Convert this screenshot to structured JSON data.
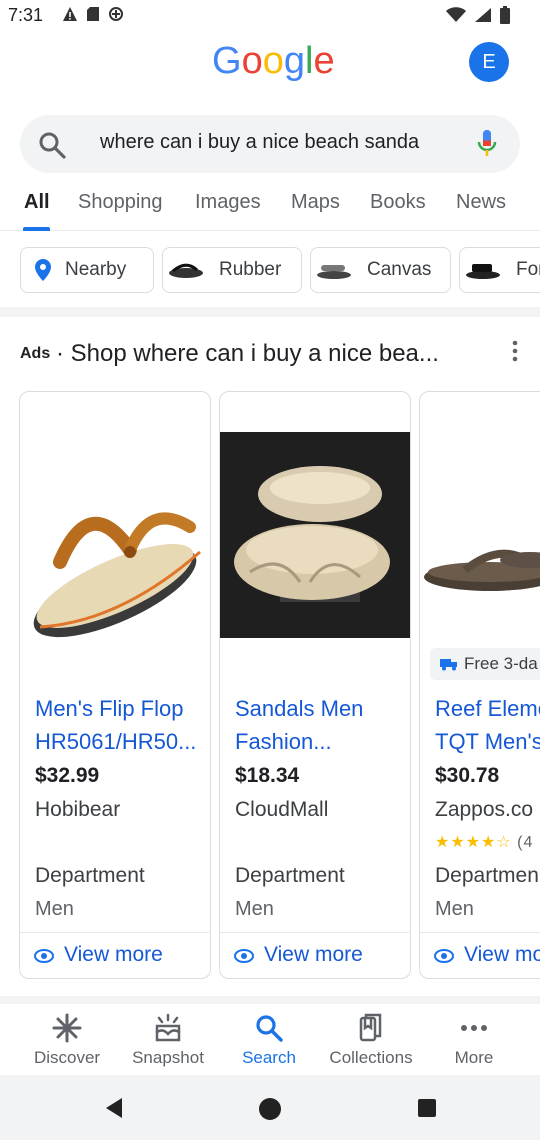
{
  "status_bar": {
    "time": "7:31",
    "left_icons": [
      "alert-icon",
      "sd-card-icon",
      "data-saver-icon"
    ],
    "right_icons": [
      "wifi-icon",
      "signal-icon",
      "battery-icon"
    ]
  },
  "header": {
    "logo_text": "Google",
    "logo_colors": [
      "#4285F4",
      "#EA4335",
      "#FBBC05",
      "#4285F4",
      "#34A853",
      "#EA4335"
    ],
    "avatar_letter": "E",
    "avatar_color": "#1a73e8"
  },
  "search": {
    "query": "where can i buy a nice beach sanda"
  },
  "tabs": [
    {
      "label": "All",
      "active": true
    },
    {
      "label": "Shopping"
    },
    {
      "label": "Images"
    },
    {
      "label": "Maps"
    },
    {
      "label": "Books"
    },
    {
      "label": "News"
    }
  ],
  "chips": [
    {
      "label": "Nearby",
      "icon": "location-pin-icon"
    },
    {
      "label": "Rubber",
      "icon": "flip-flop-thumbnail"
    },
    {
      "label": "Canvas",
      "icon": "sandal-thumbnail"
    },
    {
      "label": "For",
      "icon": "sport-sandal-thumbnail"
    }
  ],
  "ads": {
    "label": "Ads",
    "title": "· Shop where can i buy a nice bea..."
  },
  "products": [
    {
      "title_line1": "Men's Flip Flop",
      "title_line2": "HR5061/HR50...",
      "price": "$32.99",
      "store": "Hobibear",
      "department": "Department",
      "gender": "Men",
      "view_more": "View more"
    },
    {
      "title_line1": "Sandals Men",
      "title_line2": "Fashion...",
      "price": "$18.34",
      "store": "CloudMall",
      "department": "Department",
      "gender": "Men",
      "view_more": "View more"
    },
    {
      "shipping": "Free 3-da",
      "title_line1": "Reef Eleme",
      "title_line2": "TQT Men's.",
      "price": "$30.78",
      "store": "Zappos.co",
      "rating_stars": "★★★★☆",
      "rating_value": 4,
      "reviews": "(4",
      "department": "Departmen",
      "gender": "Men",
      "view_more": "View mo"
    }
  ],
  "bottom_nav": [
    {
      "label": "Discover",
      "icon": "asterisk-icon"
    },
    {
      "label": "Snapshot",
      "icon": "snapshot-icon"
    },
    {
      "label": "Search",
      "icon": "search-icon",
      "active": true
    },
    {
      "label": "Collections",
      "icon": "collections-icon"
    },
    {
      "label": "More",
      "icon": "more-icon"
    }
  ],
  "colors": {
    "accent": "#1a73e8",
    "link": "#1558d6"
  }
}
